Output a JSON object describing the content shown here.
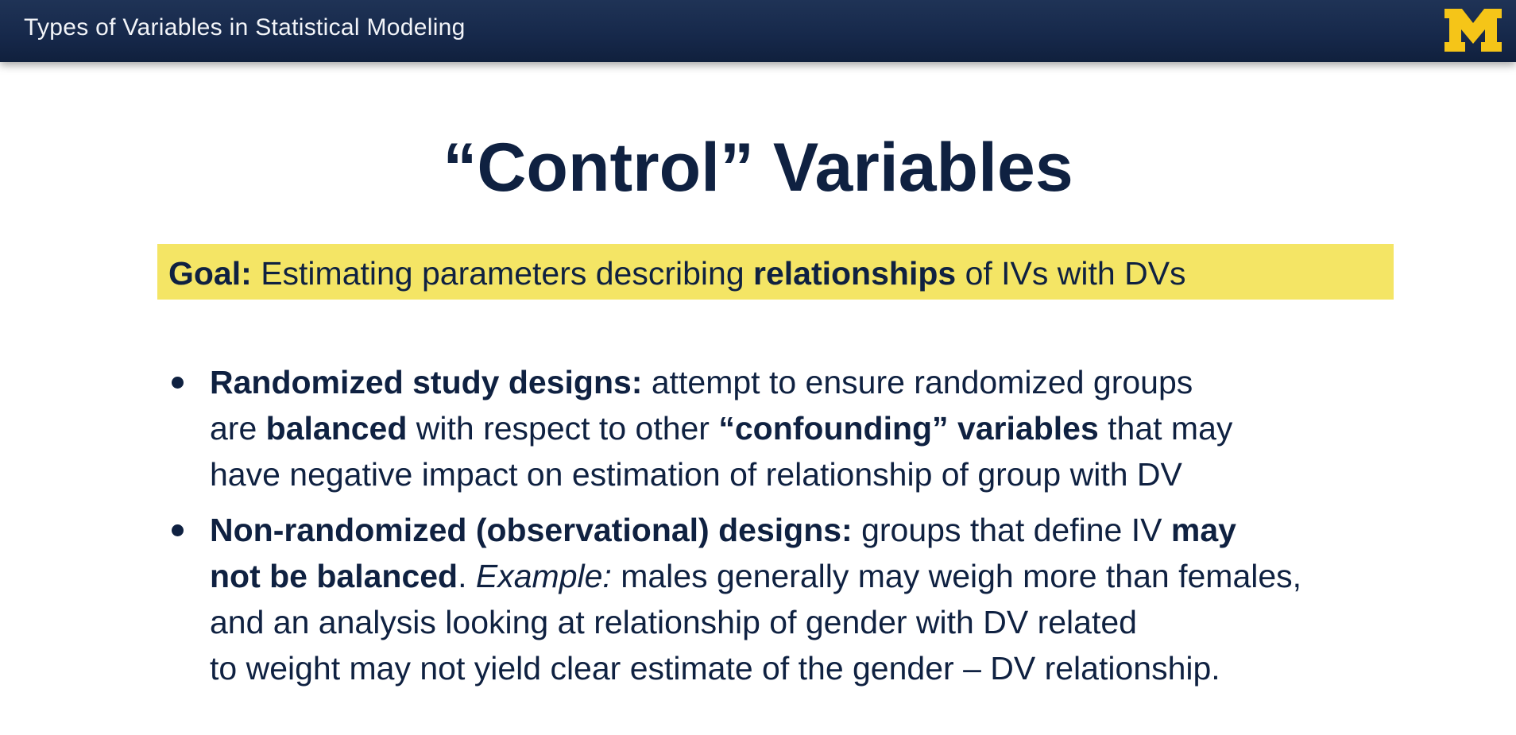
{
  "header": {
    "course_title": "Types of Variables in Statistical Modeling",
    "logo_letter": "M",
    "logo_color": "#f5c518"
  },
  "slide": {
    "title": "“Control” Variables",
    "goal": {
      "label": "Goal:",
      "text_1": " Estimating parameters describing ",
      "emphasis": "relationships",
      "text_2": " of IVs with DVs",
      "highlight_color": "#f4e565"
    },
    "bullets": [
      {
        "heading": "Randomized study designs:",
        "l1_rest": " attempt to ensure randomized groups",
        "l2_a": "are ",
        "l2_b": "balanced",
        "l2_c": " with respect to other ",
        "l2_d": "“confounding” variables",
        "l2_e": " that may",
        "l3": "have negative impact on estimation of relationship of group with DV"
      },
      {
        "heading": "Non-randomized (observational) designs:",
        "l1_rest": " groups that define IV ",
        "l1_bold_end": "may",
        "l2_bold": "not be balanced",
        "l2_a": ".  ",
        "l2_italic": "Example:",
        "l2_b": " males generally may weigh more than females,",
        "l3": "and an analysis looking at relationship of gender with DV related",
        "l4": "to weight may not yield clear estimate of the gender – DV relationship."
      }
    ]
  }
}
